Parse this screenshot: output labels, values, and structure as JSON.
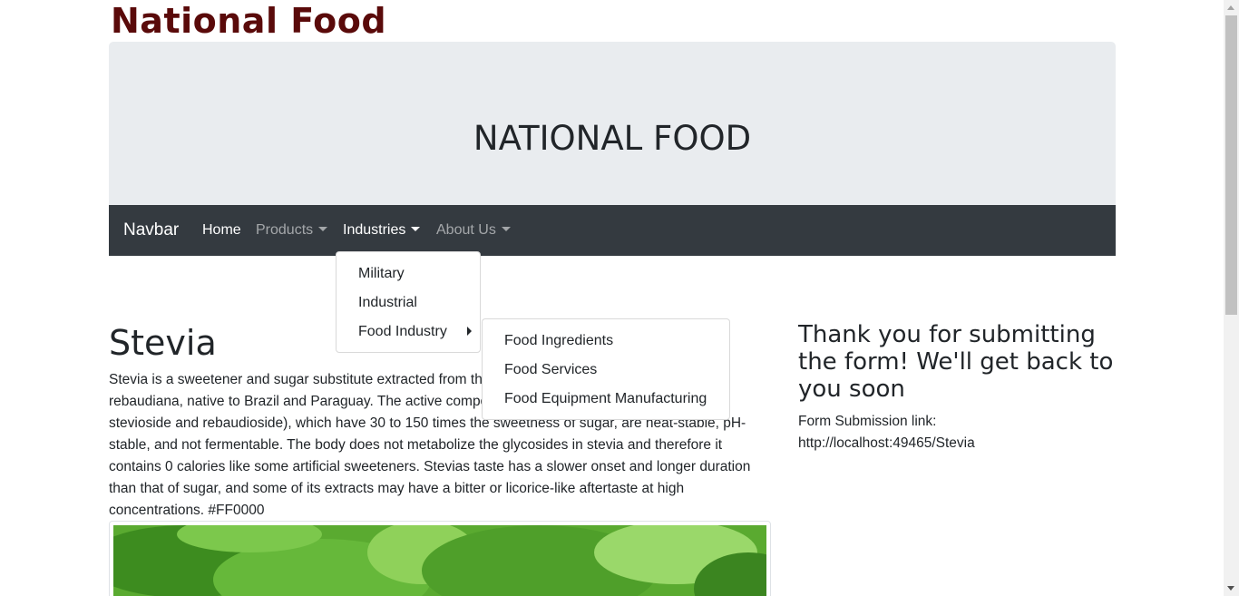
{
  "header": {
    "brand_title": "National Food"
  },
  "jumbotron": {
    "title": "NATIONAL FOOD"
  },
  "navbar": {
    "brand": "Navbar",
    "items": [
      {
        "label": "Home",
        "active": true,
        "dropdown": false
      },
      {
        "label": "Products",
        "active": false,
        "dropdown": true
      },
      {
        "label": "Industries",
        "active": true,
        "dropdown": true
      },
      {
        "label": "About Us",
        "active": false,
        "dropdown": true
      }
    ]
  },
  "industries_menu": {
    "items": [
      "Military",
      "Industrial",
      "Food Industry"
    ]
  },
  "food_industry_submenu": {
    "items": [
      "Food Ingredients",
      "Food Services",
      "Food Equipment Manufacturing"
    ]
  },
  "article": {
    "heading": "Stevia",
    "body": "Stevia is a sweetener and sugar substitute extracted from the leaves of the plant species Stevia rebaudiana, native to Brazil and Paraguay. The active compounds are steviol glycosides (mainly stevioside and rebaudioside), which have 30 to 150 times the sweetness of sugar, are heat-stable, pH-stable, and not fermentable. The body does not metabolize the glycosides in stevia and therefore it contains 0 calories like some artificial sweeteners. Stevias taste has a slower onset and longer duration than that of sugar, and some of its extracts may have a bitter or licorice-like aftertaste at high concentrations. #FF0000"
  },
  "sidebar": {
    "thanks": "Thank you for submitting the form! We'll get back to you soon",
    "link_label": "Form Submission link:",
    "link_url": "http://localhost:49465/Stevia"
  },
  "colors": {
    "brand_title": "#5a0a0a",
    "jumbotron_bg": "#e9ecef",
    "navbar_bg": "#343a40"
  }
}
